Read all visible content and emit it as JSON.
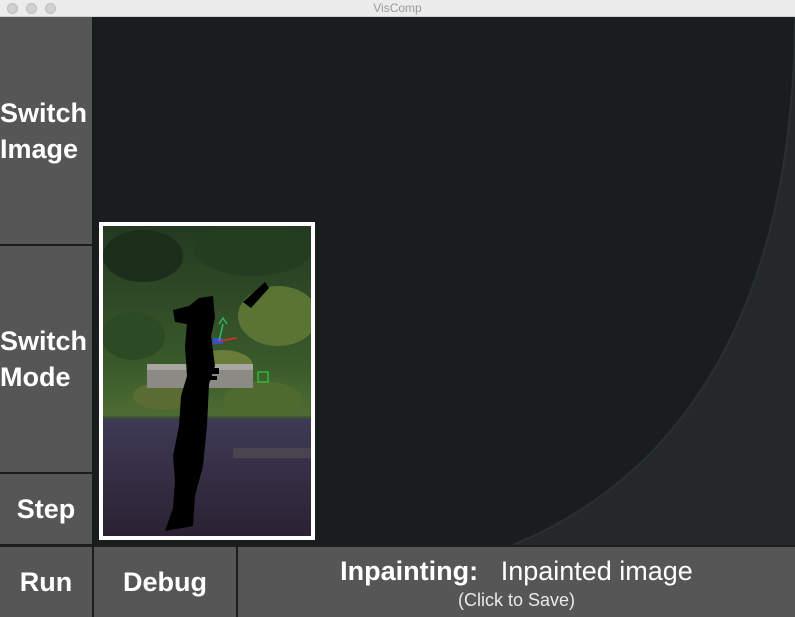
{
  "window": {
    "title": "VisComp"
  },
  "sidebar": {
    "switch_image": [
      "Switch",
      "Image"
    ],
    "switch_mode": [
      "Switch",
      "Mode"
    ],
    "step": "Step"
  },
  "bottom": {
    "run": "Run",
    "debug": "Debug"
  },
  "status": {
    "label": "Inpainting:",
    "value": "Inpainted image",
    "hint": "(Click to Save)"
  }
}
